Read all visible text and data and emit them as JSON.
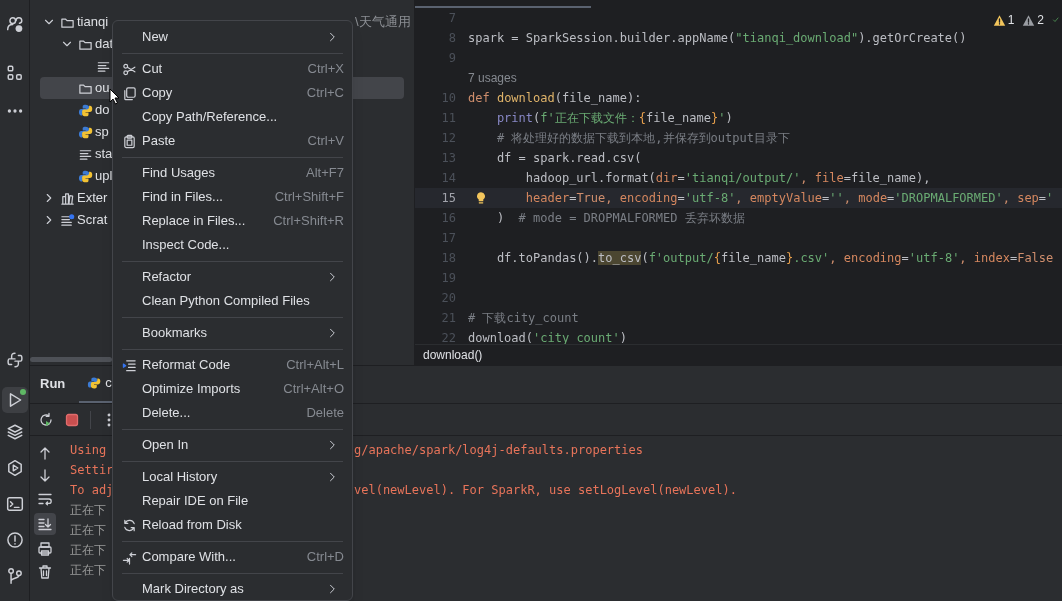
{
  "project_tree": {
    "items": [
      {
        "label": "tianqi",
        "kind": "folder",
        "expanded": true,
        "selected": false,
        "path_fragment": "\\天气通用",
        "children": [
          {
            "label": "dat",
            "kind": "folder",
            "expanded": true,
            "selected": false,
            "children": [
              {
                "kind": "text",
                "selected": false
              }
            ]
          },
          {
            "label": "ou",
            "kind": "folder",
            "selected": true
          },
          {
            "label": "do",
            "kind": "python",
            "selected": false
          },
          {
            "label": "sp",
            "kind": "python",
            "selected": false
          },
          {
            "label": "sta",
            "kind": "text",
            "selected": false
          },
          {
            "label": "upl",
            "kind": "python",
            "selected": false
          }
        ]
      },
      {
        "label": "Exter",
        "kind": "library",
        "expanded": false,
        "selected": false
      },
      {
        "label": "Scrat",
        "kind": "scratch",
        "expanded": false,
        "selected": false
      }
    ]
  },
  "editor": {
    "problems": [
      {
        "count": "1",
        "color": "#f2c55c"
      },
      {
        "count": "2",
        "color": "#9a9da3"
      }
    ],
    "lines": [
      {
        "kind": "code",
        "number": "7",
        "current": false
      },
      {
        "kind": "code",
        "number": "8",
        "current": false,
        "tokens": [
          {
            "kind": "plain",
            "text": "spark = SparkSession.builder.appName("
          },
          {
            "kind": "string",
            "text": "\"tianqi_download\""
          },
          {
            "kind": "plain",
            "text": ").getOrCreate()"
          }
        ]
      },
      {
        "kind": "code",
        "number": "9",
        "current": false
      },
      {
        "kind": "hint",
        "text": "7 usages"
      },
      {
        "kind": "code",
        "number": "10",
        "current": false,
        "tokens": [
          {
            "kind": "keyword",
            "text": "def "
          },
          {
            "kind": "function",
            "text": "download"
          },
          {
            "kind": "plain",
            "text": "(file_name):"
          }
        ]
      },
      {
        "kind": "code",
        "number": "11",
        "current": false,
        "tokens": [
          {
            "kind": "builtin",
            "text": "    print"
          },
          {
            "kind": "plain",
            "text": "("
          },
          {
            "kind": "string",
            "text": "f'正在下载文件："
          },
          {
            "kind": "brace",
            "text": "{"
          },
          {
            "kind": "plain",
            "text": "file_name"
          },
          {
            "kind": "brace",
            "text": "}"
          },
          {
            "kind": "string",
            "text": "'"
          },
          {
            "kind": "plain",
            "text": ")"
          }
        ]
      },
      {
        "kind": "code",
        "number": "12",
        "current": false,
        "tokens": [
          {
            "kind": "comment",
            "text": "    # 将处理好的数据下载到本地,并保存到output目录下"
          }
        ]
      },
      {
        "kind": "code",
        "number": "13",
        "current": false,
        "tokens": [
          {
            "kind": "plain",
            "text": "    df = spark.read.csv("
          }
        ]
      },
      {
        "kind": "code",
        "number": "14",
        "current": false,
        "tokens": [
          {
            "kind": "plain",
            "text": "        hadoop_url.format("
          },
          {
            "kind": "param",
            "text": "dir"
          },
          {
            "kind": "plain",
            "text": "="
          },
          {
            "kind": "string",
            "text": "'tianqi/output/'"
          },
          {
            "kind": "keyword",
            "text": ", "
          },
          {
            "kind": "param",
            "text": "file"
          },
          {
            "kind": "plain",
            "text": "=file_name),"
          }
        ]
      },
      {
        "kind": "code",
        "number": "15",
        "current": true,
        "bulb": true,
        "tokens": [
          {
            "kind": "param",
            "text": "        header"
          },
          {
            "kind": "plain",
            "text": "="
          },
          {
            "kind": "keyword",
            "text": "True, "
          },
          {
            "kind": "param",
            "text": "encoding"
          },
          {
            "kind": "plain",
            "text": "="
          },
          {
            "kind": "string",
            "text": "'utf-8'"
          },
          {
            "kind": "keyword",
            "text": ", "
          },
          {
            "kind": "param",
            "text": "emptyValue"
          },
          {
            "kind": "plain",
            "text": "="
          },
          {
            "kind": "string",
            "text": "''"
          },
          {
            "kind": "keyword",
            "text": ", "
          },
          {
            "kind": "param",
            "text": "mode"
          },
          {
            "kind": "plain",
            "text": "="
          },
          {
            "kind": "string",
            "text": "'DROPMALFORMED'"
          },
          {
            "kind": "keyword",
            "text": ", "
          },
          {
            "kind": "param",
            "text": "sep"
          },
          {
            "kind": "plain",
            "text": "="
          },
          {
            "kind": "string",
            "text": "'"
          }
        ]
      },
      {
        "kind": "code",
        "number": "16",
        "current": false,
        "tokens": [
          {
            "kind": "plain",
            "text": "    )  "
          },
          {
            "kind": "comment",
            "text": "# mode = DROPMALFORMED 丢弃坏数据"
          }
        ]
      },
      {
        "kind": "code",
        "number": "17",
        "current": false
      },
      {
        "kind": "code",
        "number": "18",
        "current": false,
        "tokens": [
          {
            "kind": "plain",
            "text": "    df.toPandas()."
          },
          {
            "kind": "highlight",
            "text": "to_csv"
          },
          {
            "kind": "plain",
            "text": "("
          },
          {
            "kind": "string",
            "text": "f'output/"
          },
          {
            "kind": "brace",
            "text": "{"
          },
          {
            "kind": "plain",
            "text": "file_name"
          },
          {
            "kind": "brace",
            "text": "}"
          },
          {
            "kind": "string",
            "text": ".csv'"
          },
          {
            "kind": "keyword",
            "text": ", "
          },
          {
            "kind": "param",
            "text": "encoding"
          },
          {
            "kind": "plain",
            "text": "="
          },
          {
            "kind": "string",
            "text": "'utf-8'"
          },
          {
            "kind": "keyword",
            "text": ", "
          },
          {
            "kind": "param",
            "text": "index"
          },
          {
            "kind": "plain",
            "text": "="
          },
          {
            "kind": "keyword",
            "text": "False"
          }
        ]
      },
      {
        "kind": "code",
        "number": "19",
        "current": false
      },
      {
        "kind": "code",
        "number": "20",
        "current": false
      },
      {
        "kind": "code",
        "number": "21",
        "current": false,
        "tokens": [
          {
            "kind": "comment",
            "text": "# 下载city_count"
          }
        ]
      },
      {
        "kind": "code",
        "number": "22",
        "current": false,
        "tokens": [
          {
            "kind": "plain",
            "text": "download("
          },
          {
            "kind": "string",
            "text": "'city_count'"
          },
          {
            "kind": "plain",
            "text": ")"
          }
        ]
      }
    ],
    "breadcrumb": "download()"
  },
  "run_panel": {
    "title": "Run",
    "tabs": [
      {
        "label": "c",
        "selected": true
      }
    ],
    "console": [
      {
        "kind": "stderr",
        "left": "Using",
        "right": "g/apache/spark/log4j-defaults.properties"
      },
      {
        "kind": "stderr",
        "left": "Settir"
      },
      {
        "kind": "stderr",
        "left": "To adj",
        "right": "vel(newLevel). For SparkR, use setLogLevel(newLevel)."
      },
      {
        "kind": "stdout",
        "left": "正在下"
      },
      {
        "kind": "stdout",
        "left": "正在下"
      },
      {
        "kind": "stdout",
        "left": "正在下"
      },
      {
        "kind": "stdout",
        "left": "正在下"
      }
    ]
  },
  "context_menu": {
    "items": [
      {
        "kind": "item",
        "label": "New",
        "submenu": true
      },
      {
        "kind": "separator"
      },
      {
        "kind": "item",
        "label": "Cut",
        "shortcut": "Ctrl+X"
      },
      {
        "kind": "item",
        "label": "Copy",
        "shortcut": "Ctrl+C"
      },
      {
        "kind": "item",
        "label": "Copy Path/Reference..."
      },
      {
        "kind": "item",
        "label": "Paste",
        "shortcut": "Ctrl+V"
      },
      {
        "kind": "separator"
      },
      {
        "kind": "item",
        "label": "Find Usages",
        "shortcut": "Alt+F7"
      },
      {
        "kind": "item",
        "label": "Find in Files...",
        "shortcut": "Ctrl+Shift+F"
      },
      {
        "kind": "item",
        "label": "Replace in Files...",
        "shortcut": "Ctrl+Shift+R"
      },
      {
        "kind": "item",
        "label": "Inspect Code..."
      },
      {
        "kind": "separator"
      },
      {
        "kind": "item",
        "label": "Refactor",
        "submenu": true
      },
      {
        "kind": "item",
        "label": "Clean Python Compiled Files"
      },
      {
        "kind": "separator"
      },
      {
        "kind": "item",
        "label": "Bookmarks",
        "submenu": true
      },
      {
        "kind": "separator"
      },
      {
        "kind": "item",
        "label": "Reformat Code",
        "shortcut": "Ctrl+Alt+L"
      },
      {
        "kind": "item",
        "label": "Optimize Imports",
        "shortcut": "Ctrl+Alt+O"
      },
      {
        "kind": "item",
        "label": "Delete...",
        "shortcut": "Delete"
      },
      {
        "kind": "separator"
      },
      {
        "kind": "item",
        "label": "Open In",
        "submenu": true
      },
      {
        "kind": "separator"
      },
      {
        "kind": "item",
        "label": "Local History",
        "submenu": true
      },
      {
        "kind": "item",
        "label": "Repair IDE on File"
      },
      {
        "kind": "item",
        "label": "Reload from Disk"
      },
      {
        "kind": "separator"
      },
      {
        "kind": "item",
        "label": "Compare With...",
        "shortcut": "Ctrl+D"
      },
      {
        "kind": "separator"
      },
      {
        "kind": "item",
        "label": "Mark Directory as",
        "submenu": true
      }
    ]
  }
}
